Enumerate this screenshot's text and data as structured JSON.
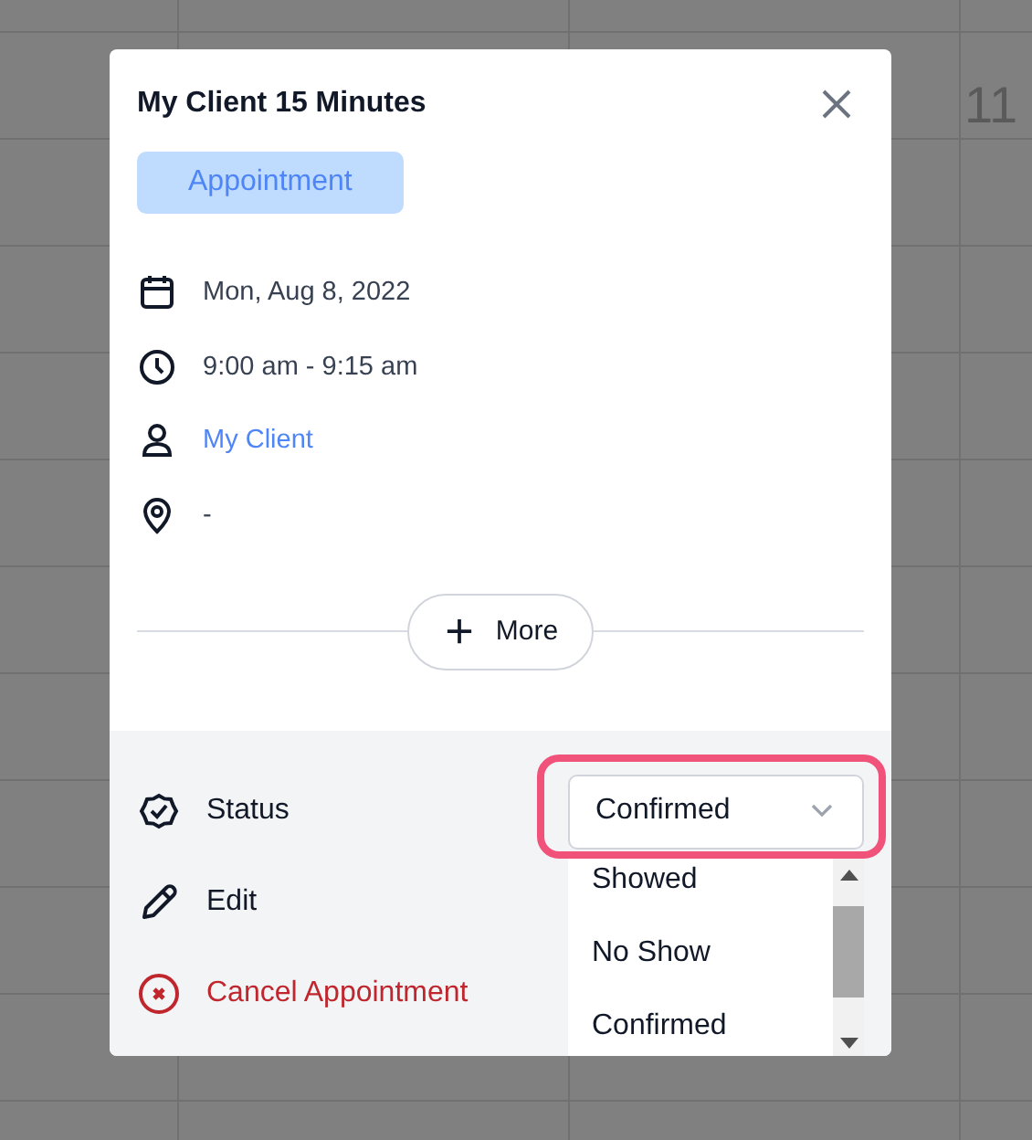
{
  "calendar_background": {
    "day_label": "11"
  },
  "dialog": {
    "title": "My Client 15 Minutes",
    "type_badge": "Appointment",
    "details": [
      {
        "kind": "date",
        "text": "Mon, Aug 8, 2022",
        "link": false
      },
      {
        "kind": "time",
        "text": "9:00 am - 9:15 am",
        "link": false
      },
      {
        "kind": "client",
        "text": "My Client",
        "link": true
      },
      {
        "kind": "location",
        "text": "-",
        "link": false
      }
    ],
    "more_button": "More",
    "actions": [
      {
        "kind": "status",
        "label": "Status"
      },
      {
        "kind": "edit",
        "label": "Edit"
      },
      {
        "kind": "cancel",
        "label": "Cancel Appointment"
      }
    ],
    "status_select": {
      "value": "Confirmed",
      "highlighted": true,
      "expanded": true,
      "options": [
        "Showed",
        "No Show",
        "Confirmed"
      ]
    }
  }
}
